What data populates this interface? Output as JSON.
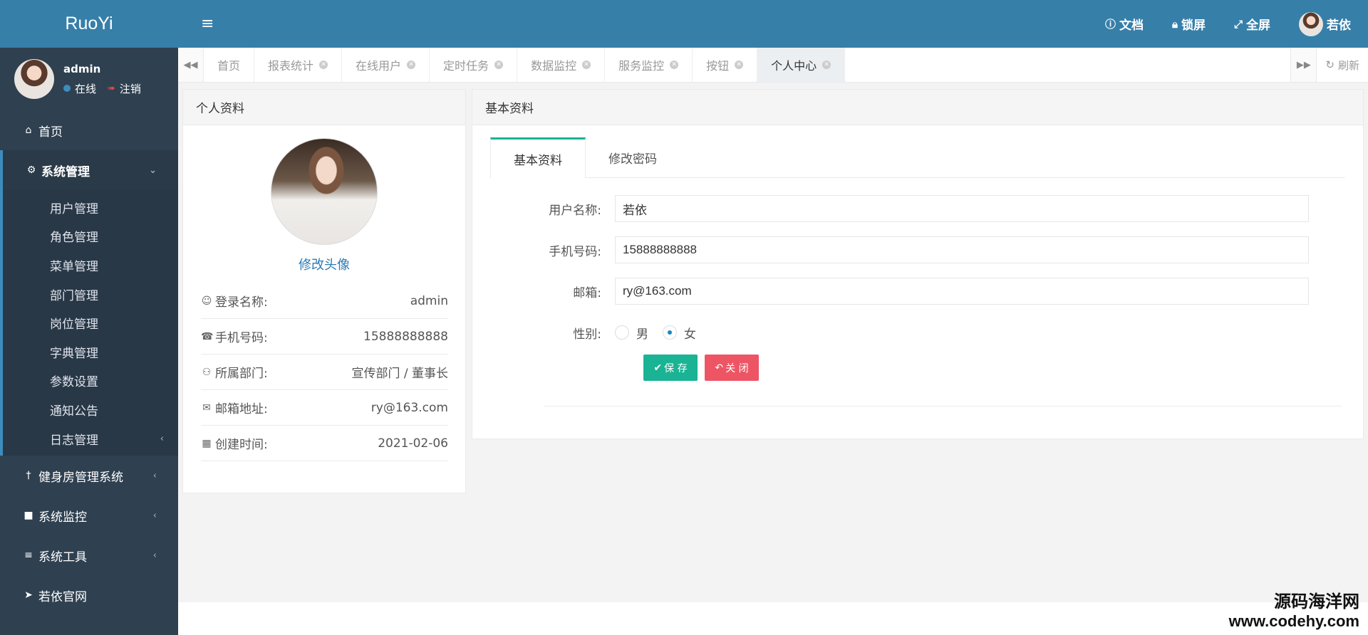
{
  "app": {
    "logo": "RuoYi"
  },
  "user_panel": {
    "name": "admin",
    "status": "在线",
    "logout": "注销"
  },
  "sidebar": {
    "home": "首页",
    "system": "系统管理",
    "system_items": [
      "用户管理",
      "角色管理",
      "菜单管理",
      "部门管理",
      "岗位管理",
      "字典管理",
      "参数设置",
      "通知公告",
      "日志管理"
    ],
    "gym": "健身房管理系统",
    "monitor": "系统监控",
    "tools": "系统工具",
    "official": "若依官网"
  },
  "header": {
    "docs": "文档",
    "lock": "锁屏",
    "fullscreen": "全屏",
    "username": "若依"
  },
  "tabs": [
    "首页",
    "报表统计",
    "在线用户",
    "定时任务",
    "数据监控",
    "服务监控",
    "按钮",
    "个人中心"
  ],
  "tabs_refresh": "刷新",
  "profile": {
    "title": "个人资料",
    "change_avatar": "修改头像",
    "rows": [
      {
        "label": "登录名称:",
        "value": "admin"
      },
      {
        "label": "手机号码:",
        "value": "15888888888"
      },
      {
        "label": "所属部门:",
        "value": "宣传部门 / 董事长"
      },
      {
        "label": "邮箱地址:",
        "value": "ry@163.com"
      },
      {
        "label": "创建时间:",
        "value": "2021-02-06"
      }
    ]
  },
  "basic": {
    "title": "基本资料",
    "tab_basic": "基本资料",
    "tab_password": "修改密码",
    "fields": {
      "username_label": "用户名称:",
      "username_value": "若依",
      "phone_label": "手机号码:",
      "phone_value": "15888888888",
      "email_label": "邮箱:",
      "email_value": "ry@163.com",
      "gender_label": "性别:",
      "gender_male": "男",
      "gender_female": "女"
    },
    "save": "保 存",
    "close": "关 闭"
  },
  "watermark": {
    "line1": "源码海洋网",
    "line2": "www.codehy.com"
  },
  "colors": {
    "header": "#367fa9",
    "sidebar": "#2f4050",
    "save": "#1ab394",
    "close": "#ed5565",
    "link": "#2d7ab4"
  }
}
